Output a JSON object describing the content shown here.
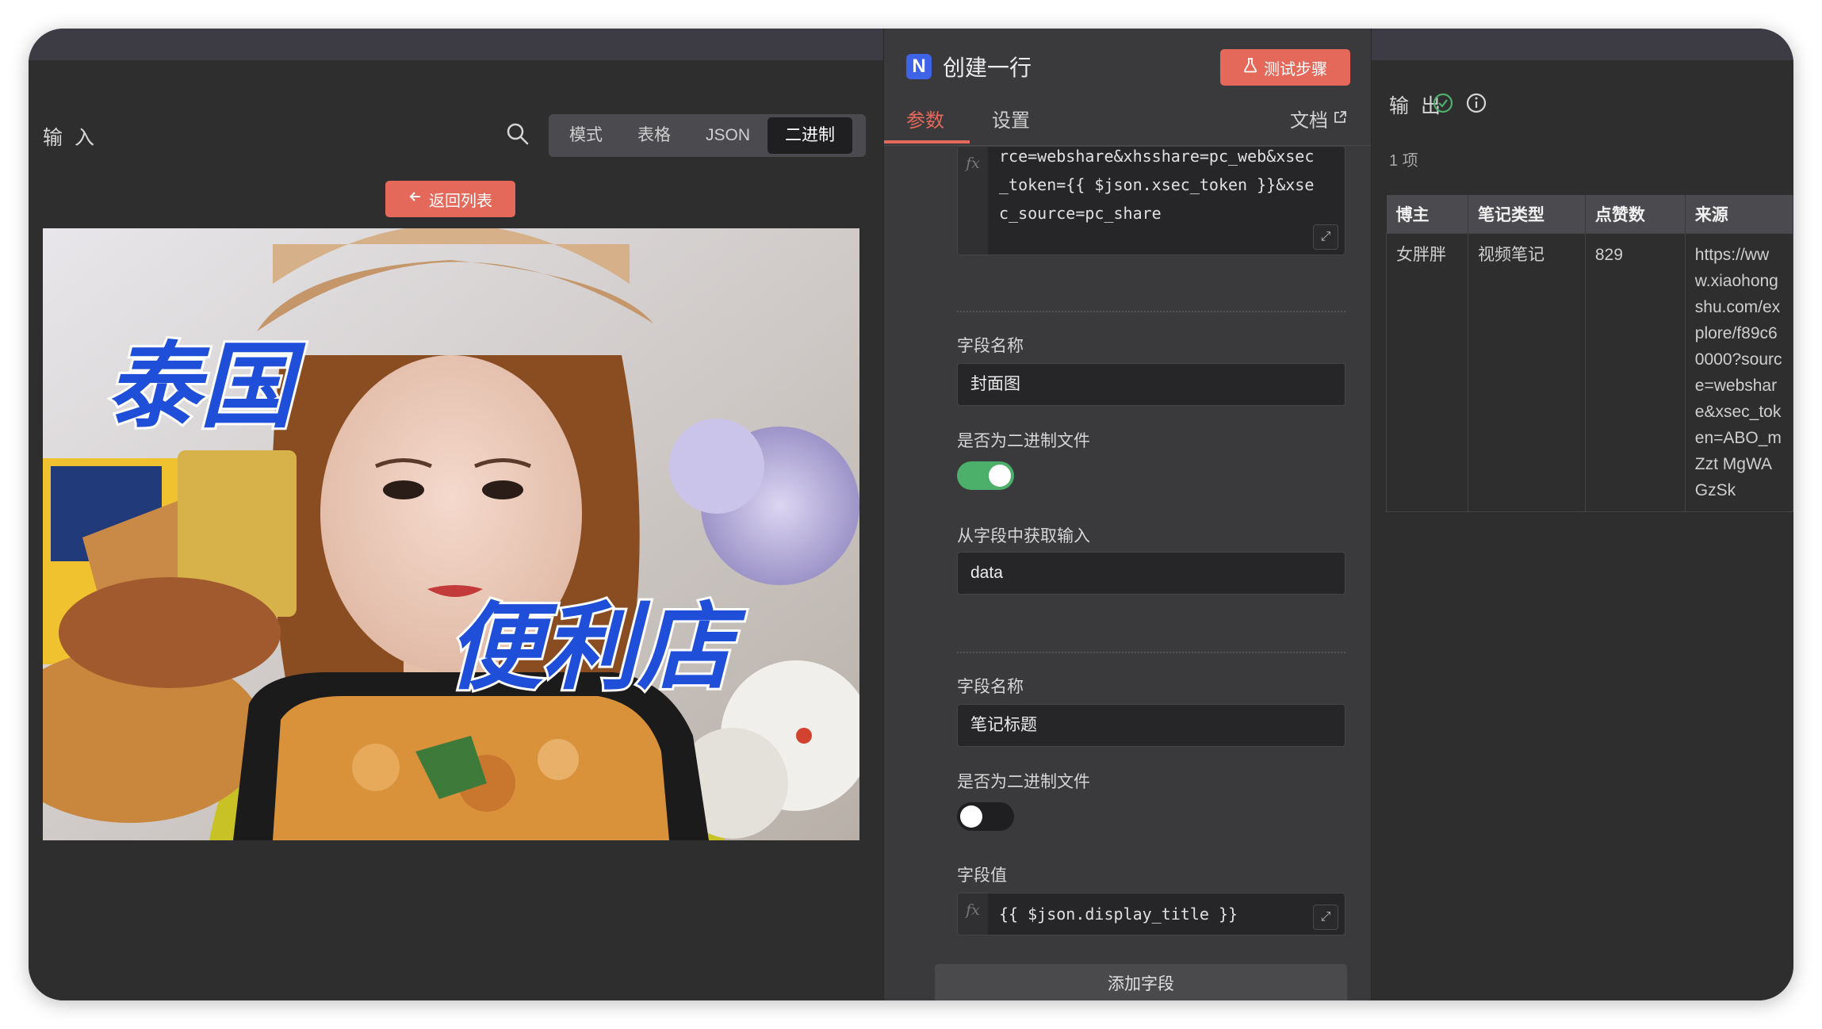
{
  "input": {
    "title": "输 入",
    "view_tabs": [
      "模式",
      "表格",
      "JSON",
      "二进制"
    ],
    "active_tab": "二进制",
    "back_button": "返回列表"
  },
  "node": {
    "title": "创建一行",
    "test_button": "测试步骤",
    "tabs": {
      "params": "参数",
      "settings": "设置"
    },
    "docs": "文档",
    "top_expression": [
      "rce=webshare&xhsshare=pc_web&xsec",
      "_token={{ $json.xsec_token }}&xse",
      "c_source=pc_share"
    ],
    "fields": [
      {
        "name_label": "字段名称",
        "name_value": "封面图",
        "binary_label": "是否为二进制文件",
        "binary": true,
        "input_label": "从字段中获取输入",
        "input_value": "data"
      },
      {
        "name_label": "字段名称",
        "name_value": "笔记标题",
        "binary_label": "是否为二进制文件",
        "binary": false,
        "value_label": "字段值",
        "value_expr": "{{ $json.display_title }}"
      }
    ],
    "add_field": "添加字段"
  },
  "output": {
    "title": "输 出",
    "count": "1 项",
    "columns": [
      "博主",
      "笔记类型",
      "点赞数",
      "来源"
    ],
    "rows": [
      [
        "女胖胖",
        "视频笔记",
        "829",
        "https://www.xiaohongshu.com/explore/f89c60000?source=webshare&xsec_token=ABO_mZzt MgWAGzSk"
      ]
    ]
  },
  "colors": {
    "accent": "#e5695a",
    "toggle_on": "#4caf6a",
    "brand": "#3f63e6"
  }
}
